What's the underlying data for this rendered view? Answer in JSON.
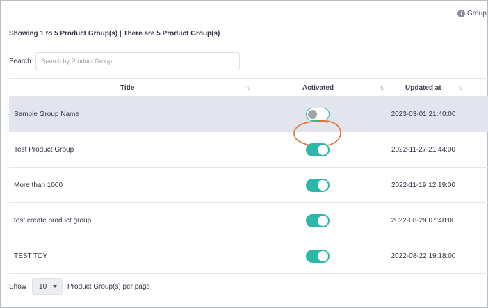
{
  "header": {
    "group_label": "Group",
    "info_icon": "i",
    "summary": "Showing 1 to 5 Product Group(s) | There are 5 Product Group(s)"
  },
  "search": {
    "label": "Search:",
    "placeholder": "Search by Product Group",
    "value": ""
  },
  "table": {
    "columns": [
      {
        "label": "Title",
        "sort_icon": "↑↓"
      },
      {
        "label": "Activated",
        "sort_icon": "↑↓"
      },
      {
        "label": "Updated at",
        "sort_icon": "↑↓"
      }
    ],
    "rows": [
      {
        "title": "Sample Group Name",
        "activated": false,
        "updated_at": "2023-03-01 21:40:00",
        "highlighted": true
      },
      {
        "title": "Test Product Group",
        "activated": true,
        "updated_at": "2022-11-27 21:44:00",
        "highlighted": false
      },
      {
        "title": "More than 1000",
        "activated": true,
        "updated_at": "2022-11-19 12:19:00",
        "highlighted": false
      },
      {
        "title": "test create product group",
        "activated": true,
        "updated_at": "2022-08-29 07:48:00",
        "highlighted": false
      },
      {
        "title": "TEST TOY",
        "activated": true,
        "updated_at": "2022-08-22 19:18:00",
        "highlighted": false
      }
    ]
  },
  "footer": {
    "show_label": "Show",
    "per_page_value": "10",
    "per_page_suffix": "Product Group(s) per page"
  },
  "colors": {
    "toggle_on": "#2bb8a8",
    "row_highlight": "#e2e5ee",
    "annotation": "#e07035"
  }
}
